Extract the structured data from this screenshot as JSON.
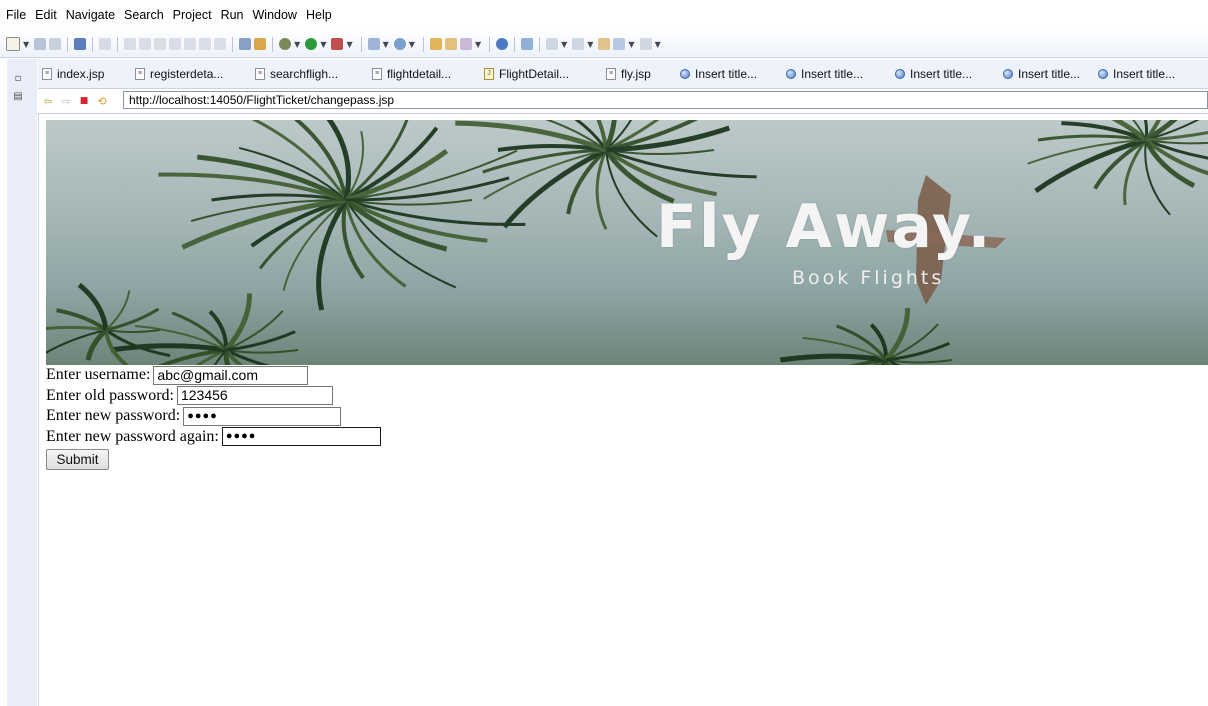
{
  "menu": [
    "File",
    "Edit",
    "Navigate",
    "Search",
    "Project",
    "Run",
    "Window",
    "Help"
  ],
  "tabs": [
    {
      "label": "index.jsp",
      "icon": "file-icon"
    },
    {
      "label": "registerdeta...",
      "icon": "file-icon"
    },
    {
      "label": "searchfligh...",
      "icon": "file-icon"
    },
    {
      "label": "flightdetail...",
      "icon": "file-icon"
    },
    {
      "label": "FlightDetail...",
      "icon": "java-file-icon"
    },
    {
      "label": "fly.jsp",
      "icon": "file-icon"
    },
    {
      "label": "Insert title...",
      "icon": "globe-icon"
    },
    {
      "label": "Insert title...",
      "icon": "globe-icon"
    },
    {
      "label": "Insert title...",
      "icon": "globe-icon"
    },
    {
      "label": "Insert title...",
      "icon": "globe-icon"
    },
    {
      "label": "Insert title...",
      "icon": "globe-icon"
    }
  ],
  "browser": {
    "url": "http://localhost:14050/FlightTicket/changepass.jsp"
  },
  "banner": {
    "brand": "Fly Away.",
    "tagline": "Book Flights"
  },
  "form": {
    "username_label": "Enter username:",
    "username_value": "abc@gmail.com",
    "old_password_label": "Enter old password:",
    "old_password_value": "123456",
    "new_password_label": "Enter new password:",
    "new_password_value": "●●●●",
    "new_password_again_label": "Enter new password again:",
    "new_password_again_value": "●●●●",
    "submit_label": "Submit"
  },
  "colors": {
    "toolbar_bg": "#ecf1fa",
    "tab_bg": "#eef3fb",
    "side_strip": "#e8edf8"
  }
}
